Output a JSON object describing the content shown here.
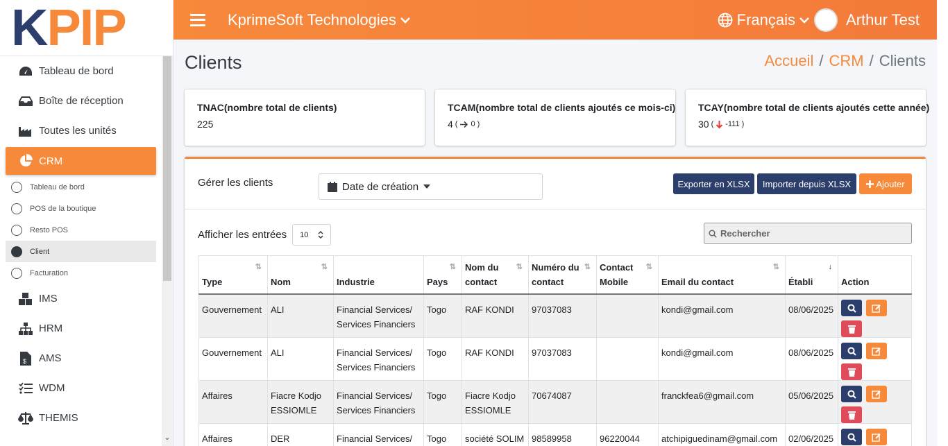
{
  "brand": {
    "logo_k": "K",
    "logo_pip": "PIP"
  },
  "topbar": {
    "company": "KprimeSoft Technologies",
    "language": "Français",
    "user": "Arthur Test"
  },
  "sidebar": {
    "items": [
      {
        "label": "Tableau de bord",
        "icon": "dashboard-icon"
      },
      {
        "label": "Boîte de réception",
        "icon": "inbox-icon"
      },
      {
        "label": "Toutes les unités",
        "icon": "industry-icon"
      },
      {
        "label": "CRM",
        "icon": "pie-chart-icon"
      }
    ],
    "sub_items": [
      {
        "label": "Tableau de bord"
      },
      {
        "label": "POS de la boutique"
      },
      {
        "label": "Resto POS"
      },
      {
        "label": "Client"
      },
      {
        "label": "Facturation"
      }
    ],
    "modules": [
      {
        "label": "IMS",
        "icon": "boxes-icon"
      },
      {
        "label": "HRM",
        "icon": "org-chart-icon"
      },
      {
        "label": "AMS",
        "icon": "invoice-dollar-icon"
      },
      {
        "label": "WDM",
        "icon": "checklist-icon"
      },
      {
        "label": "THEMIS",
        "icon": "balance-scale-icon"
      }
    ]
  },
  "page": {
    "title": "Clients",
    "breadcrumb": [
      "Accueil",
      "CRM",
      "Clients"
    ]
  },
  "stats": [
    {
      "label": "TNAC(nombre total de clients)",
      "value": "225",
      "delta": ""
    },
    {
      "label": "TCAM(nombre total de clients ajoutés ce mois-ci)",
      "value": "4",
      "delta": "0"
    },
    {
      "label": "TCAY(nombre total de clients ajoutés cette année)",
      "value": "30",
      "delta": "-111"
    }
  ],
  "toolbar": {
    "manage_label": "Gérer les clients",
    "date_filter": "Date de création",
    "export_label": "Exporter en XLSX",
    "import_label": "Importer depuis XLSX",
    "add_label": "Ajouter"
  },
  "table_controls": {
    "show_label": "Afficher les entrées",
    "page_size": "10",
    "search_placeholder": "Rechercher"
  },
  "table": {
    "headers": [
      "Type",
      "Nom",
      "Industrie",
      "Pays",
      "Nom du contact",
      "Numéro du contact",
      "Contact Mobile",
      "Email du contact",
      "Établi",
      "Action"
    ],
    "rows": [
      {
        "type": "Gouvernement",
        "nom": "ALI",
        "industrie": "Financial Services/ Services Financiers",
        "pays": "Togo",
        "contact": "RAF KONDI",
        "numero": "97037083",
        "mobile": "",
        "email": "kondi@gmail.com",
        "etabli": "08/06/2025"
      },
      {
        "type": "Gouvernement",
        "nom": "ALI",
        "industrie": "Financial Services/ Services Financiers",
        "pays": "Togo",
        "contact": "RAF KONDI",
        "numero": "97037083",
        "mobile": "",
        "email": "kondi@gmail.com",
        "etabli": "08/06/2025"
      },
      {
        "type": "Affaires",
        "nom": "Fiacre Kodjo ESSIOMLE",
        "industrie": "Financial Services/ Services Financiers",
        "pays": "Togo",
        "contact": "Fiacre Kodjo ESSIOMLE",
        "numero": "70674087",
        "mobile": "",
        "email": "franckfea6@gmail.com",
        "etabli": "05/06/2025"
      },
      {
        "type": "Affaires",
        "nom": "DER",
        "industrie": "Financial Services/ Services Financiers",
        "pays": "Togo",
        "contact": "société SOLIM",
        "numero": "98589958",
        "mobile": "96220044",
        "email": "atchipiguedinam@gmail.com",
        "etabli": "02/06/2025"
      }
    ]
  },
  "colors": {
    "accent": "#f7893b",
    "navy": "#2c3e6b",
    "danger": "#e04b5a"
  }
}
